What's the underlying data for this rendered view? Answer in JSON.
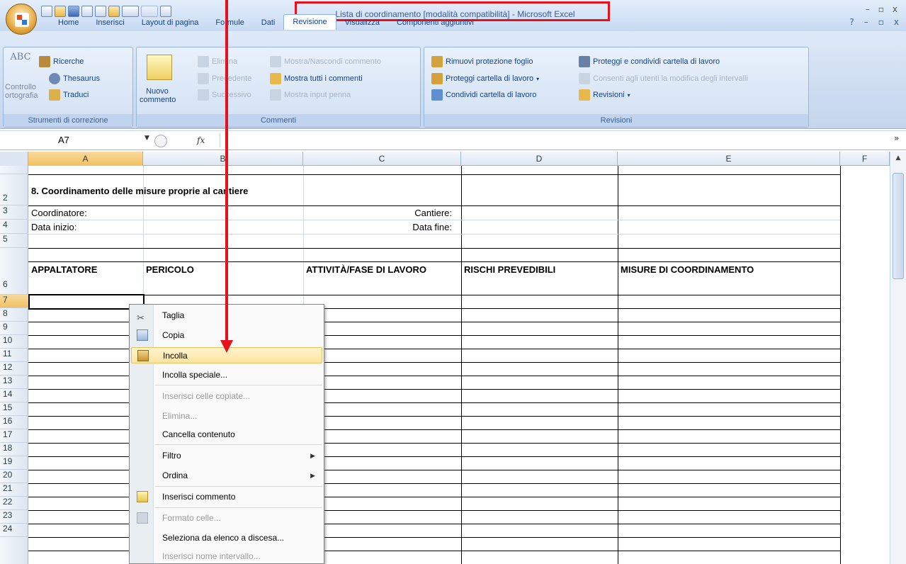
{
  "title": {
    "text": "Lista di coordinamento  [modalità compatibilità] - Microsoft Excel"
  },
  "ribbon": {
    "tabs": [
      "Home",
      "Inserisci",
      "Layout di pagina",
      "Formule",
      "Dati",
      "Revisione",
      "Visualizza",
      "Componenti aggiuntivi"
    ],
    "active_tab": "Revisione",
    "groups": {
      "strumenti": {
        "label": "Strumenti di correzione",
        "controllo_abc": "ABC",
        "controllo": "Controllo",
        "ortografia": "ortografia",
        "ricerche": "Ricerche",
        "thesaurus": "Thesaurus",
        "traduci": "Traduci"
      },
      "commenti": {
        "label": "Commenti",
        "nuovo": "Nuovo",
        "commento": "commento",
        "elimina": "Elimina",
        "precedente": "Precedente",
        "successivo": "Successivo",
        "mostra_nascondi": "Mostra/Nascondi commento",
        "mostra_tutti": "Mostra tutti i commenti",
        "mostra_input": "Mostra input penna"
      },
      "revisioni": {
        "label": "Revisioni",
        "rimuovi": "Rimuovi protezione foglio",
        "proteggi_cartella": "Proteggi cartella di lavoro",
        "condividi": "Condividi cartella di lavoro",
        "proteggi_condividi": "Proteggi e condividi cartella di lavoro",
        "consenti": "Consenti agli utenti la modifica degli intervalli",
        "revisioni_btn": "Revisioni"
      }
    }
  },
  "formula_bar": {
    "name_box": "A7",
    "fx": "fx",
    "formula": ""
  },
  "columns": [
    "A",
    "B",
    "C",
    "D",
    "E",
    "F"
  ],
  "rows": [
    "2",
    "3",
    "4",
    "5",
    "6",
    "7",
    "8",
    "9",
    "10",
    "11",
    "12",
    "13",
    "14",
    "15",
    "16",
    "17",
    "18",
    "19",
    "20",
    "21",
    "22",
    "23",
    "24"
  ],
  "sheet": {
    "heading": "8. Coordinamento delle misure proprie al cantiere",
    "coordinatore": "Coordinatore:",
    "data_inizio": "Data inizio:",
    "cantiere": "Cantiere:",
    "data_fine": "Data fine:",
    "col_headers": [
      "APPALTATORE",
      "PERICOLO",
      "ATTIVITÀ/FASE DI LAVORO",
      "RISCHI PREVEDIBILI",
      "MISURE DI COORDINAMENTO"
    ]
  },
  "context_menu": {
    "items": [
      {
        "label": "Taglia",
        "icon": "scissors-icon",
        "enabled": true
      },
      {
        "label": "Copia",
        "icon": "copy-icon",
        "enabled": true
      },
      {
        "label": "Incolla",
        "icon": "paste-icon",
        "enabled": true,
        "highlighted": true
      },
      {
        "label": "Incolla speciale...",
        "enabled": true
      },
      {
        "label": "Inserisci celle copiate...",
        "enabled": false
      },
      {
        "label": "Elimina...",
        "enabled": false
      },
      {
        "label": "Cancella contenuto",
        "enabled": true
      },
      {
        "label": "Filtro",
        "enabled": true,
        "submenu": true
      },
      {
        "label": "Ordina",
        "enabled": true,
        "submenu": true
      },
      {
        "label": "Inserisci commento",
        "icon": "comment-icon",
        "enabled": true
      },
      {
        "label": "Formato celle...",
        "icon": "format-cells-icon",
        "enabled": false
      },
      {
        "label": "Seleziona da elenco a discesa...",
        "enabled": true
      },
      {
        "label": "Inserisci nome intervallo...",
        "enabled": false
      }
    ]
  },
  "annotation_color": "#e8101a"
}
